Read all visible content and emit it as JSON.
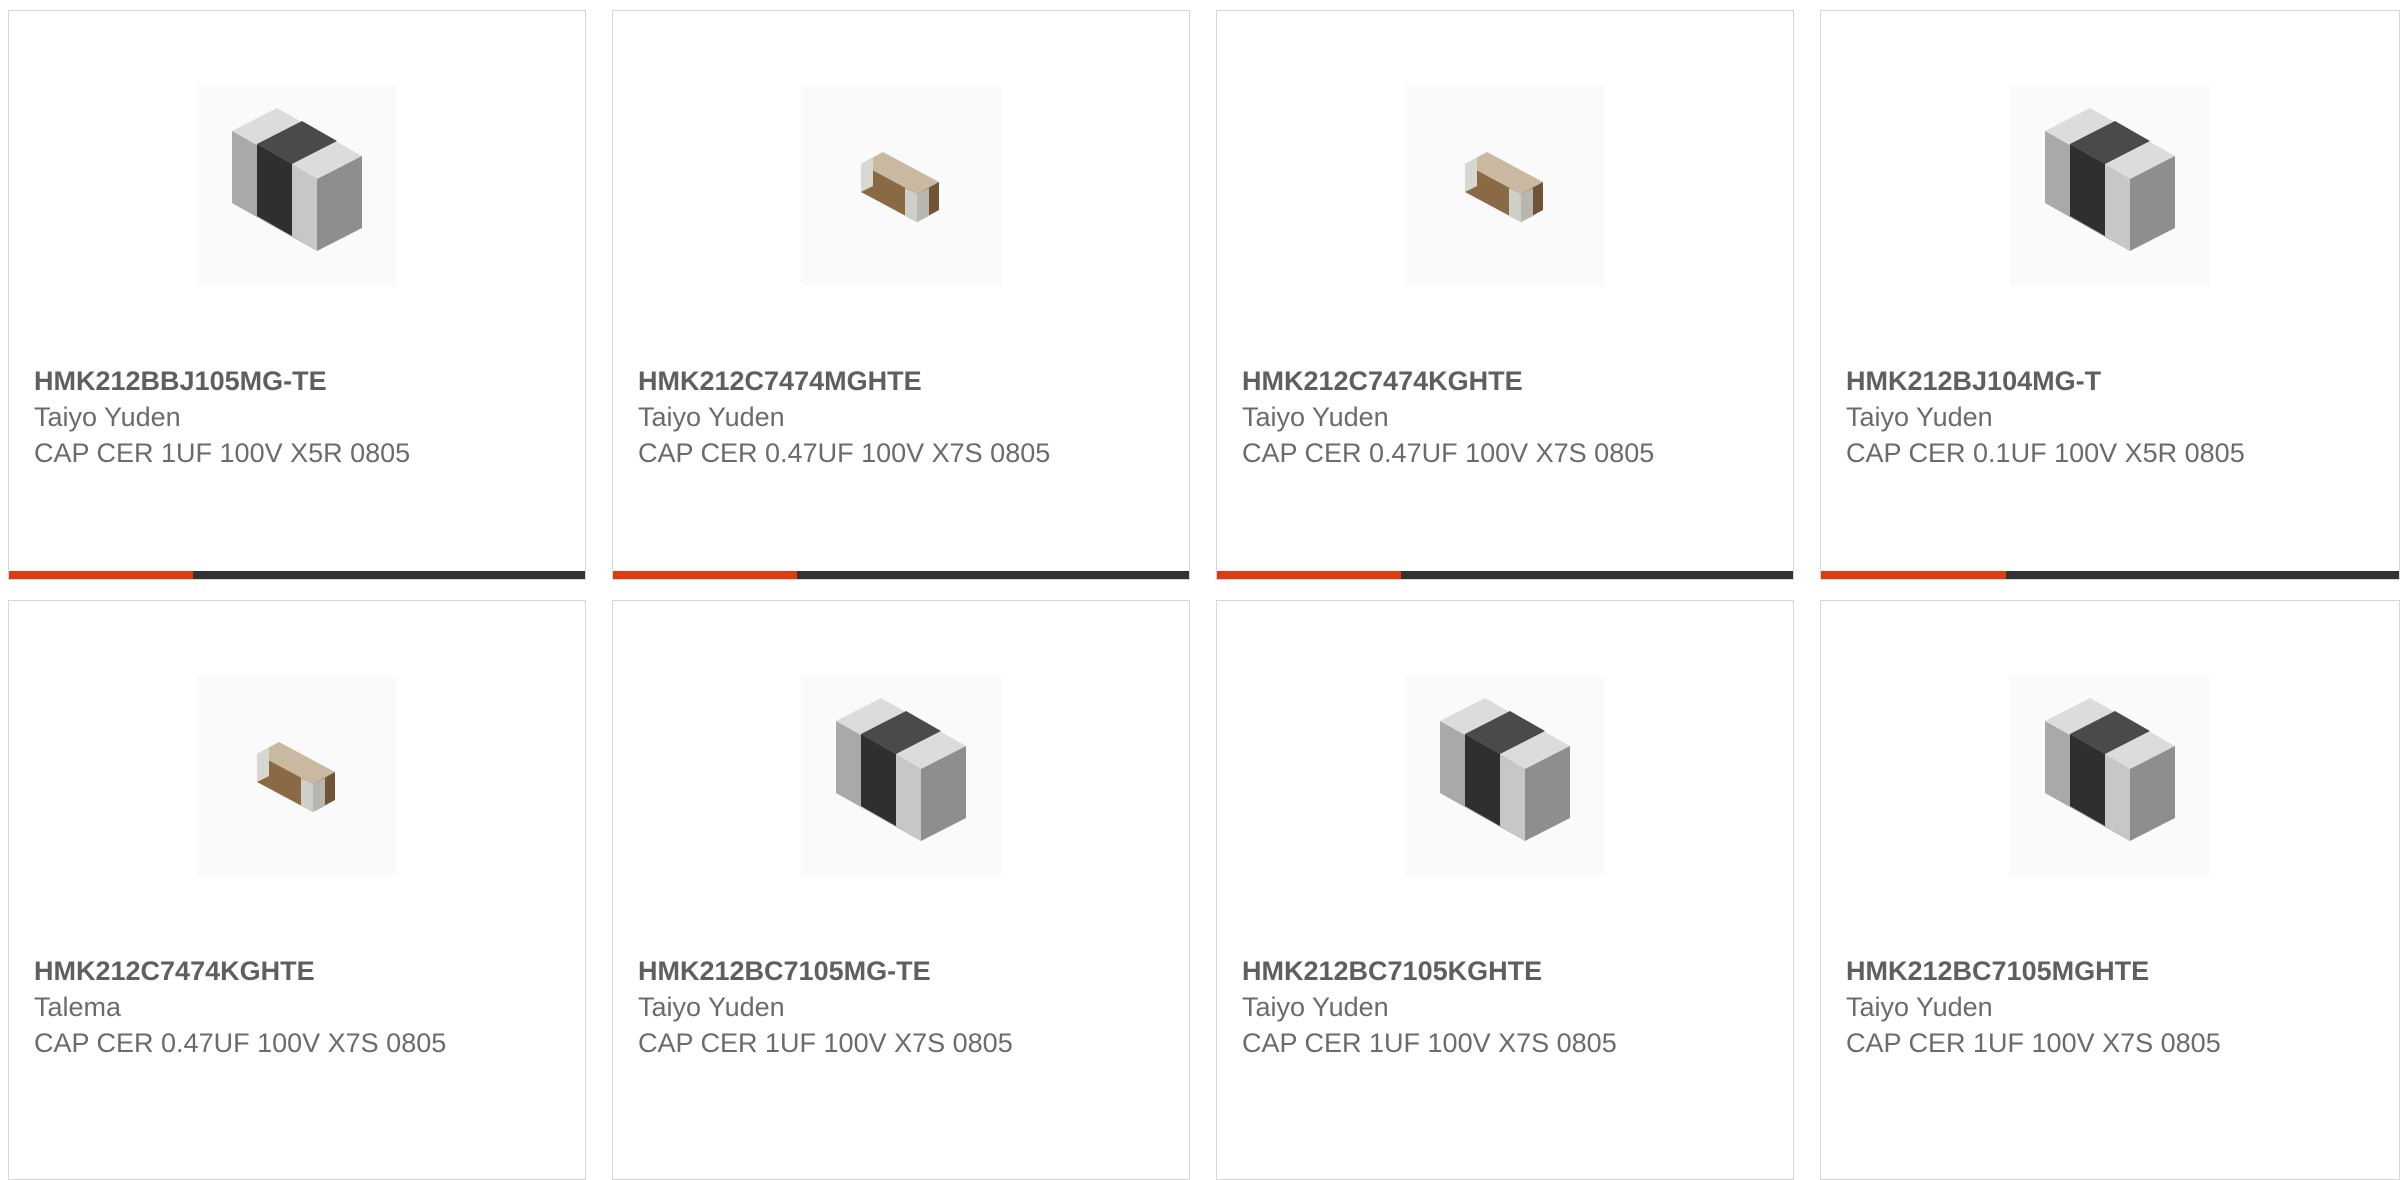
{
  "colors": {
    "accent": "#e03a10",
    "bar_track": "#333333",
    "card_border": "#d6d6d6",
    "text": "#666666"
  },
  "products": [
    {
      "part_number": "HMK212BBJ105MG-TE",
      "manufacturer": "Taiyo Yuden",
      "description": "CAP CER 1UF 100V X5R 0805",
      "image": "capacitor-gray-icon",
      "progress": 0.32
    },
    {
      "part_number": "HMK212C7474MGHTE",
      "manufacturer": "Taiyo Yuden",
      "description": "CAP CER 0.47UF 100V X7S 0805",
      "image": "capacitor-brown-icon",
      "progress": 0.32
    },
    {
      "part_number": "HMK212C7474KGHTE",
      "manufacturer": "Taiyo Yuden",
      "description": "CAP CER 0.47UF 100V X7S 0805",
      "image": "capacitor-brown-icon",
      "progress": 0.32
    },
    {
      "part_number": "HMK212BJ104MG-T",
      "manufacturer": "Taiyo Yuden",
      "description": "CAP CER 0.1UF 100V X5R 0805",
      "image": "capacitor-gray-icon",
      "progress": 0.32
    },
    {
      "part_number": "HMK212C7474KGHTE",
      "manufacturer": "Talema",
      "description": "CAP CER 0.47UF 100V X7S 0805",
      "image": "capacitor-brown-icon",
      "progress": null
    },
    {
      "part_number": "HMK212BC7105MG-TE",
      "manufacturer": "Taiyo Yuden",
      "description": "CAP CER 1UF 100V X7S 0805",
      "image": "capacitor-gray-icon",
      "progress": null
    },
    {
      "part_number": "HMK212BC7105KGHTE",
      "manufacturer": "Taiyo Yuden",
      "description": "CAP CER 1UF 100V X7S 0805",
      "image": "capacitor-gray-icon",
      "progress": null
    },
    {
      "part_number": "HMK212BC7105MGHTE",
      "manufacturer": "Taiyo Yuden",
      "description": "CAP CER 1UF 100V X7S 0805",
      "image": "capacitor-gray-icon",
      "progress": null
    }
  ]
}
